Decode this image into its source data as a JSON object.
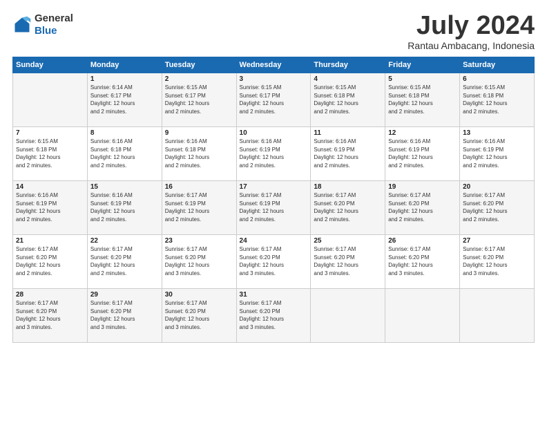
{
  "logo": {
    "general": "General",
    "blue": "Blue"
  },
  "title": "July 2024",
  "subtitle": "Rantau Ambacang, Indonesia",
  "days_header": [
    "Sunday",
    "Monday",
    "Tuesday",
    "Wednesday",
    "Thursday",
    "Friday",
    "Saturday"
  ],
  "weeks": [
    [
      {
        "num": "",
        "info": ""
      },
      {
        "num": "1",
        "info": "Sunrise: 6:14 AM\nSunset: 6:17 PM\nDaylight: 12 hours\nand 2 minutes."
      },
      {
        "num": "2",
        "info": "Sunrise: 6:15 AM\nSunset: 6:17 PM\nDaylight: 12 hours\nand 2 minutes."
      },
      {
        "num": "3",
        "info": "Sunrise: 6:15 AM\nSunset: 6:17 PM\nDaylight: 12 hours\nand 2 minutes."
      },
      {
        "num": "4",
        "info": "Sunrise: 6:15 AM\nSunset: 6:18 PM\nDaylight: 12 hours\nand 2 minutes."
      },
      {
        "num": "5",
        "info": "Sunrise: 6:15 AM\nSunset: 6:18 PM\nDaylight: 12 hours\nand 2 minutes."
      },
      {
        "num": "6",
        "info": "Sunrise: 6:15 AM\nSunset: 6:18 PM\nDaylight: 12 hours\nand 2 minutes."
      }
    ],
    [
      {
        "num": "7",
        "info": "Sunrise: 6:15 AM\nSunset: 6:18 PM\nDaylight: 12 hours\nand 2 minutes."
      },
      {
        "num": "8",
        "info": "Sunrise: 6:16 AM\nSunset: 6:18 PM\nDaylight: 12 hours\nand 2 minutes."
      },
      {
        "num": "9",
        "info": "Sunrise: 6:16 AM\nSunset: 6:18 PM\nDaylight: 12 hours\nand 2 minutes."
      },
      {
        "num": "10",
        "info": "Sunrise: 6:16 AM\nSunset: 6:19 PM\nDaylight: 12 hours\nand 2 minutes."
      },
      {
        "num": "11",
        "info": "Sunrise: 6:16 AM\nSunset: 6:19 PM\nDaylight: 12 hours\nand 2 minutes."
      },
      {
        "num": "12",
        "info": "Sunrise: 6:16 AM\nSunset: 6:19 PM\nDaylight: 12 hours\nand 2 minutes."
      },
      {
        "num": "13",
        "info": "Sunrise: 6:16 AM\nSunset: 6:19 PM\nDaylight: 12 hours\nand 2 minutes."
      }
    ],
    [
      {
        "num": "14",
        "info": "Sunrise: 6:16 AM\nSunset: 6:19 PM\nDaylight: 12 hours\nand 2 minutes."
      },
      {
        "num": "15",
        "info": "Sunrise: 6:16 AM\nSunset: 6:19 PM\nDaylight: 12 hours\nand 2 minutes."
      },
      {
        "num": "16",
        "info": "Sunrise: 6:17 AM\nSunset: 6:19 PM\nDaylight: 12 hours\nand 2 minutes."
      },
      {
        "num": "17",
        "info": "Sunrise: 6:17 AM\nSunset: 6:19 PM\nDaylight: 12 hours\nand 2 minutes."
      },
      {
        "num": "18",
        "info": "Sunrise: 6:17 AM\nSunset: 6:20 PM\nDaylight: 12 hours\nand 2 minutes."
      },
      {
        "num": "19",
        "info": "Sunrise: 6:17 AM\nSunset: 6:20 PM\nDaylight: 12 hours\nand 2 minutes."
      },
      {
        "num": "20",
        "info": "Sunrise: 6:17 AM\nSunset: 6:20 PM\nDaylight: 12 hours\nand 2 minutes."
      }
    ],
    [
      {
        "num": "21",
        "info": "Sunrise: 6:17 AM\nSunset: 6:20 PM\nDaylight: 12 hours\nand 2 minutes."
      },
      {
        "num": "22",
        "info": "Sunrise: 6:17 AM\nSunset: 6:20 PM\nDaylight: 12 hours\nand 2 minutes."
      },
      {
        "num": "23",
        "info": "Sunrise: 6:17 AM\nSunset: 6:20 PM\nDaylight: 12 hours\nand 3 minutes."
      },
      {
        "num": "24",
        "info": "Sunrise: 6:17 AM\nSunset: 6:20 PM\nDaylight: 12 hours\nand 3 minutes."
      },
      {
        "num": "25",
        "info": "Sunrise: 6:17 AM\nSunset: 6:20 PM\nDaylight: 12 hours\nand 3 minutes."
      },
      {
        "num": "26",
        "info": "Sunrise: 6:17 AM\nSunset: 6:20 PM\nDaylight: 12 hours\nand 3 minutes."
      },
      {
        "num": "27",
        "info": "Sunrise: 6:17 AM\nSunset: 6:20 PM\nDaylight: 12 hours\nand 3 minutes."
      }
    ],
    [
      {
        "num": "28",
        "info": "Sunrise: 6:17 AM\nSunset: 6:20 PM\nDaylight: 12 hours\nand 3 minutes."
      },
      {
        "num": "29",
        "info": "Sunrise: 6:17 AM\nSunset: 6:20 PM\nDaylight: 12 hours\nand 3 minutes."
      },
      {
        "num": "30",
        "info": "Sunrise: 6:17 AM\nSunset: 6:20 PM\nDaylight: 12 hours\nand 3 minutes."
      },
      {
        "num": "31",
        "info": "Sunrise: 6:17 AM\nSunset: 6:20 PM\nDaylight: 12 hours\nand 3 minutes."
      },
      {
        "num": "",
        "info": ""
      },
      {
        "num": "",
        "info": ""
      },
      {
        "num": "",
        "info": ""
      }
    ]
  ]
}
